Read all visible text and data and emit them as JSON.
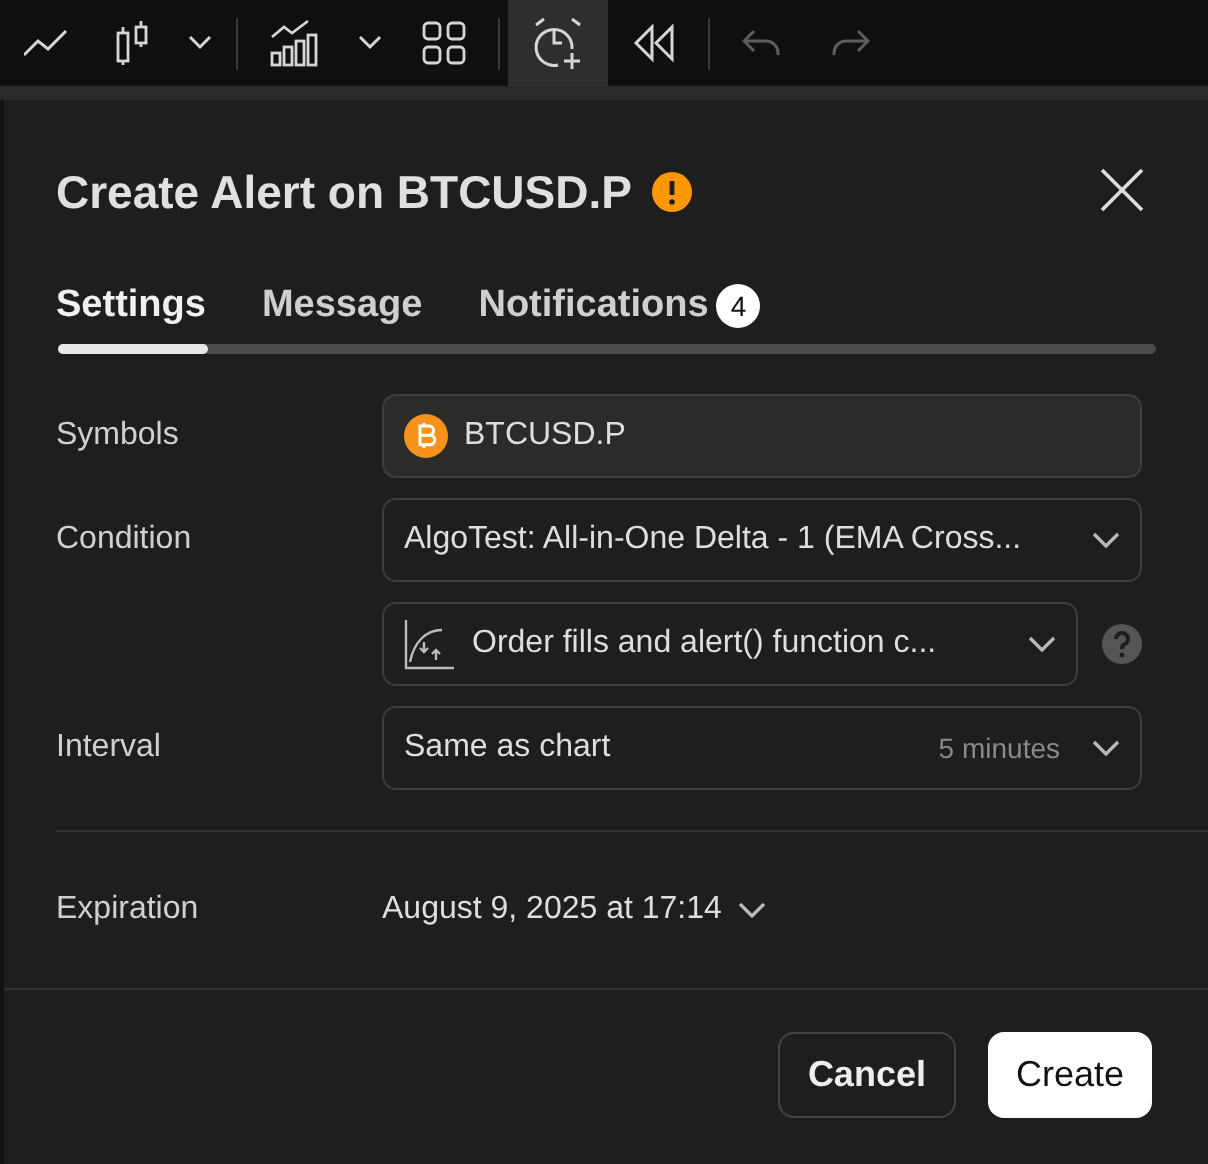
{
  "toolbar": {
    "items": [
      {
        "kind": "line",
        "selected": false,
        "disabled": false
      },
      {
        "kind": "candles",
        "selected": false,
        "disabled": false
      },
      {
        "kind": "caret",
        "selected": false,
        "disabled": false
      },
      {
        "kind": "divider"
      },
      {
        "kind": "indicators",
        "selected": false,
        "disabled": false
      },
      {
        "kind": "caret",
        "selected": false,
        "disabled": false
      },
      {
        "kind": "grid",
        "selected": false,
        "disabled": false
      },
      {
        "kind": "divider"
      },
      {
        "kind": "alert",
        "selected": true,
        "disabled": false
      },
      {
        "kind": "rewind",
        "selected": false,
        "disabled": false
      },
      {
        "kind": "divider"
      },
      {
        "kind": "undo",
        "selected": false,
        "disabled": true
      },
      {
        "kind": "redo",
        "selected": false,
        "disabled": true
      }
    ]
  },
  "dialog": {
    "title": "Create Alert on BTCUSD.P",
    "tabs": [
      {
        "label": "Settings",
        "selected": true
      },
      {
        "label": "Message",
        "selected": false
      },
      {
        "label": "Notifications",
        "selected": false,
        "badge": "4"
      }
    ],
    "rows": [
      {
        "kind": "symbol",
        "label": "Symbols",
        "value": "BTCUSD.P"
      },
      {
        "kind": "select",
        "label": "Condition",
        "value": "AlgoTest: All-in-One Delta - 1 (EMA Cross..."
      },
      {
        "kind": "strategy",
        "value": "Order fills and alert() function c..."
      },
      {
        "kind": "select",
        "label": "Interval",
        "value": "Same as chart",
        "hint": "5 minutes"
      }
    ],
    "expiration": {
      "label": "Expiration",
      "value": "August 9, 2025 at 17:14"
    },
    "buttons": [
      {
        "label": "Cancel",
        "kind": "secondary"
      },
      {
        "label": "Create",
        "kind": "primary"
      }
    ]
  }
}
